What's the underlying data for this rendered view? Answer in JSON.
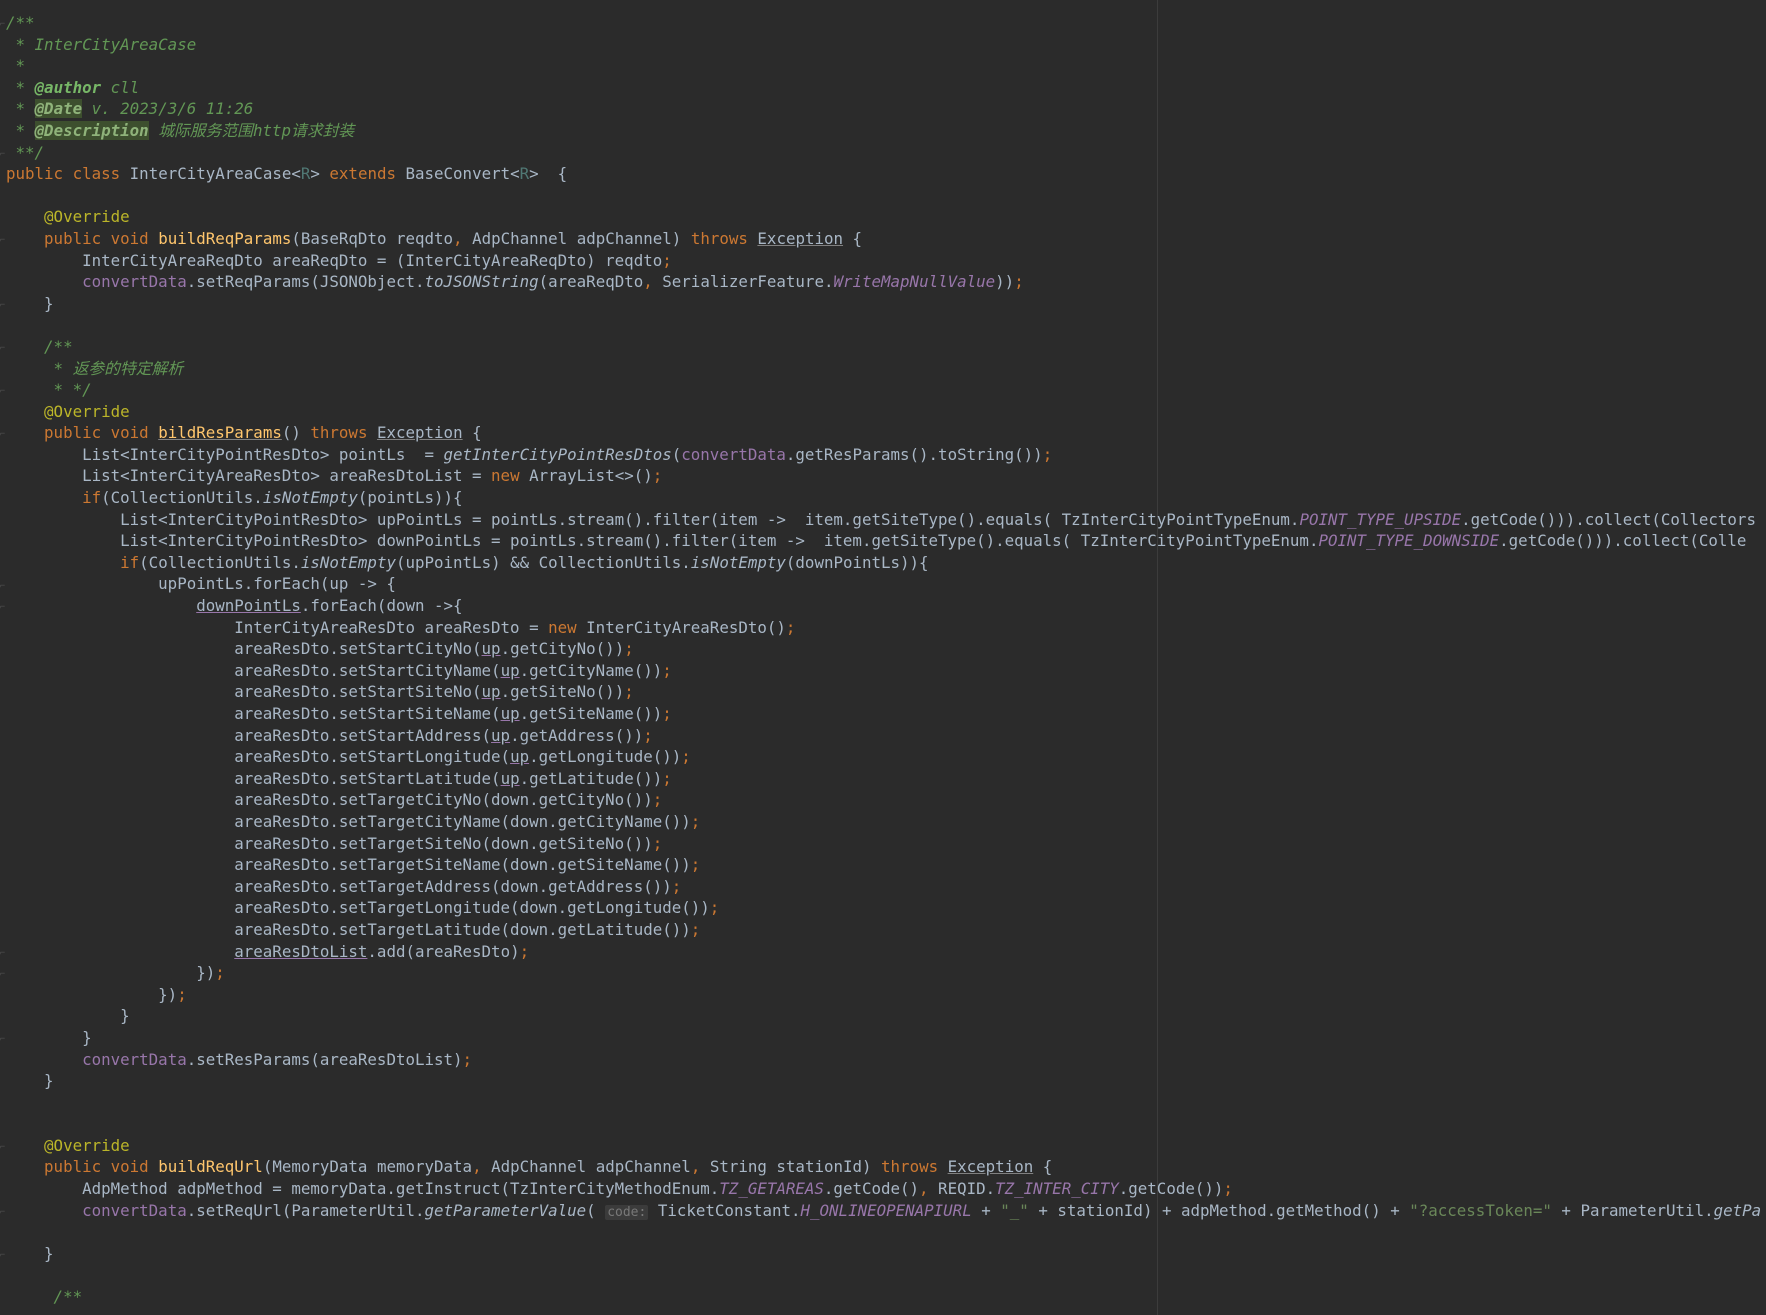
{
  "code_lines": [
    "/**",
    " * InterCityAreaCase",
    " *",
    " * @author cll",
    " * @Date v. 2023/3/6 11:26",
    " * @Description 城际服务范围http请求封装",
    " **/",
    "public class InterCityAreaCase<R> extends BaseConvert<R>  {",
    "",
    "    @Override",
    "    public void buildReqParams(BaseRqDto reqdto, AdpChannel adpChannel) throws Exception {",
    "        InterCityAreaReqDto areaReqDto = (InterCityAreaReqDto) reqdto;",
    "        convertData.setReqParams(JSONObject.toJSONString(areaReqDto, SerializerFeature.WriteMapNullValue));",
    "    }",
    "",
    "    /**",
    "     * 返参的特定解析",
    "     * */",
    "    @Override",
    "    public void bildResParams() throws Exception {",
    "        List<InterCityPointResDto> pointLs  = getInterCityPointResDtos(convertData.getResParams().toString());",
    "        List<InterCityAreaResDto> areaResDtoList = new ArrayList<>();",
    "        if(CollectionUtils.isNotEmpty(pointLs)){",
    "            List<InterCityPointResDto> upPointLs = pointLs.stream().filter(item ->  item.getSiteType().equals( TzInterCityPointTypeEnum.POINT_TYPE_UPSIDE.getCode())).collect(Collectors",
    "            List<InterCityPointResDto> downPointLs = pointLs.stream().filter(item ->  item.getSiteType().equals( TzInterCityPointTypeEnum.POINT_TYPE_DOWNSIDE.getCode())).collect(Colle",
    "            if(CollectionUtils.isNotEmpty(upPointLs) && CollectionUtils.isNotEmpty(downPointLs)){",
    "                upPointLs.forEach(up -> {",
    "                    downPointLs.forEach(down ->{",
    "                        InterCityAreaResDto areaResDto = new InterCityAreaResDto();",
    "                        areaResDto.setStartCityNo(up.getCityNo());",
    "                        areaResDto.setStartCityName(up.getCityName());",
    "                        areaResDto.setStartSiteNo(up.getSiteNo());",
    "                        areaResDto.setStartSiteName(up.getSiteName());",
    "                        areaResDto.setStartAddress(up.getAddress());",
    "                        areaResDto.setStartLongitude(up.getLongitude());",
    "                        areaResDto.setStartLatitude(up.getLatitude());",
    "                        areaResDto.setTargetCityNo(down.getCityNo());",
    "                        areaResDto.setTargetCityName(down.getCityName());",
    "                        areaResDto.setTargetSiteNo(down.getSiteNo());",
    "                        areaResDto.setTargetSiteName(down.getSiteName());",
    "                        areaResDto.setTargetAddress(down.getAddress());",
    "                        areaResDto.setTargetLongitude(down.getLongitude());",
    "                        areaResDto.setTargetLatitude(down.getLatitude());",
    "                        areaResDtoList.add(areaResDto);",
    "                    });",
    "                });",
    "            }",
    "        }",
    "        convertData.setResParams(areaResDtoList);",
    "    }",
    "",
    "",
    "    @Override",
    "    public void buildReqUrl(MemoryData memoryData, AdpChannel adpChannel, String stationId) throws Exception {",
    "        AdpMethod adpMethod = memoryData.getInstruct(TzInterCityMethodEnum.TZ_GETAREAS.getCode(), REQID.TZ_INTER_CITY.getCode());",
    "        convertData.setReqUrl(ParameterUtil.getParameterValue( code: TicketConstant.H_ONLINEOPENAPIURL + \"_\" + stationId) + adpMethod.getMethod() + \"?accessToken=\" + ParameterUtil.getPa",
    "",
    "    }",
    "",
    "     /**"
  ],
  "colors": {
    "background": "#2b2b2b",
    "keyword": "#cc7832",
    "annotation": "#bbb529",
    "string": "#6a8759",
    "comment": "#629755",
    "method_declaration": "#ffc66d",
    "field": "#9876aa",
    "default_text": "#a9b7c6"
  }
}
